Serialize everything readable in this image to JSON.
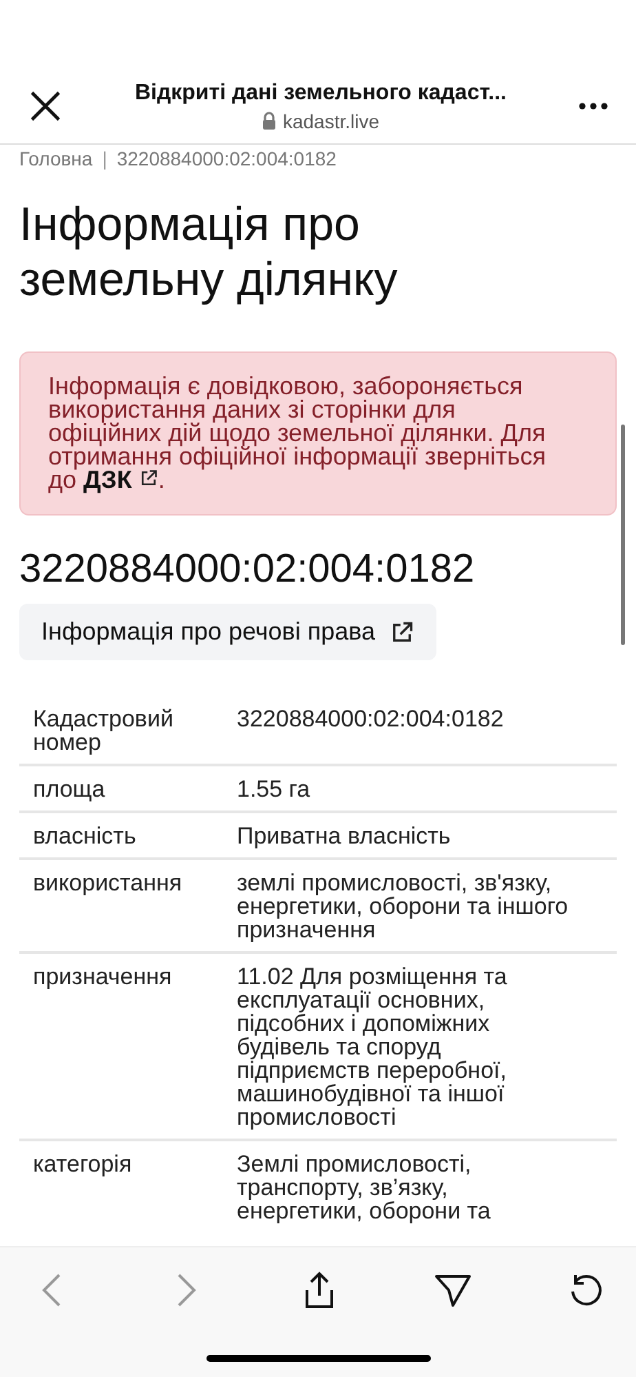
{
  "browser": {
    "title": "Відкриті дані земельного кадаст...",
    "domain": "kadastr.live"
  },
  "breadcrumb": {
    "items": [
      "Головна",
      "3220884000:02:004:0182"
    ],
    "separator": "|"
  },
  "heading": "Інформація про земельну ділянку",
  "alert": {
    "text": "Інформація є довідковою, забороняється використання даних зі сторінки для офіційних дій щодо земельної ділянки. Для отримання офіційної інформації зверніться до",
    "link": "ДЗК",
    "after": "."
  },
  "parcel_number": "3220884000:02:004:0182",
  "rights_button": "Інформація про речові права",
  "table": {
    "rows": [
      {
        "label": "Кадастровий номер",
        "value": "3220884000:02:004:0182"
      },
      {
        "label": "площа",
        "value": "1.55 га"
      },
      {
        "label": "власність",
        "value": "Приватна власність"
      },
      {
        "label": "використання",
        "value": "землі промисловості, зв'язку, енергетики, оборони та іншого призначення"
      },
      {
        "label": "призначення",
        "value": "11.02 Для розміщення та експлуатації основних, підсобних і допоміжних будівель та споруд підприємств переробної, машинобудівної та іншої промисловості"
      },
      {
        "label": "категорія",
        "value": "Землі промисловості, транспорту, зв’язку, енергетики, оборони та"
      }
    ]
  },
  "toolbar": [
    {
      "kind": "back",
      "disabled": true
    },
    {
      "kind": "forward",
      "disabled": true
    },
    {
      "kind": "share",
      "disabled": false
    },
    {
      "kind": "send",
      "disabled": false
    },
    {
      "kind": "reload",
      "disabled": false
    }
  ]
}
